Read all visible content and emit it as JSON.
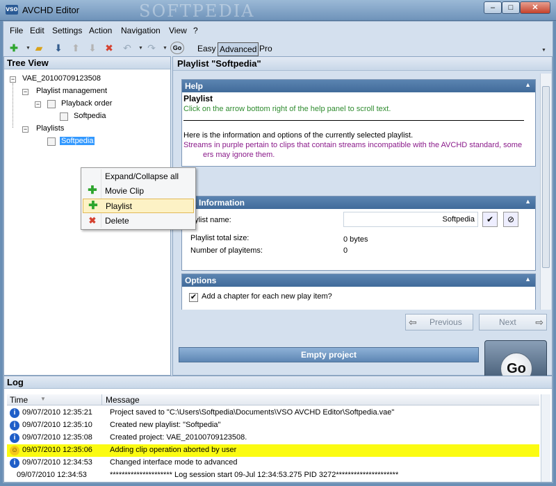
{
  "window": {
    "title": "AVCHD Editor",
    "watermark": "SOFTPEDIA",
    "app_icon_text": "vso"
  },
  "menubar": [
    "File",
    "Edit",
    "Settings",
    "Action",
    "Navigation",
    "View",
    "?"
  ],
  "toolbar": {
    "modes": [
      "Easy",
      "Advanced",
      "Pro"
    ],
    "active_mode": "Advanced",
    "go_label": "Go"
  },
  "tree": {
    "title": "Tree View",
    "root": "VAE_20100709123508",
    "playlist_management": "Playlist management",
    "playback_order": "Playback order",
    "playback_item": "Softpedia",
    "playlists": "Playlists",
    "selected_playlist": "Softpedia"
  },
  "context_menu": {
    "items": [
      "Expand/Collapse all",
      "Movie Clip",
      "Playlist",
      "Delete"
    ],
    "hovered": "Playlist"
  },
  "main": {
    "title": "Playlist \"Softpedia\"",
    "help": {
      "header": "Help",
      "heading": "Playlist",
      "hint": "Click on the arrow bottom right of the help panel to scroll text.",
      "text": "Here is the information and options of the currently selected playlist.",
      "purple_text": "Streams in purple pertain to clips that contain streams incompatible with the AVCHD standard, some",
      "purple_text2": "ers may ignore them."
    },
    "basic_info": {
      "header": "sic Information",
      "name_label": "aylist name:",
      "name_value": "Softpedia",
      "size_label": "Playlist total size:",
      "size_value": "0 bytes",
      "items_label": "Number of playitems:",
      "items_value": "0"
    },
    "options": {
      "header": "Options",
      "chapter_label": "Add a chapter for each new play item?",
      "chapter_checked": true
    },
    "nav": {
      "previous": "Previous",
      "next": "Next"
    },
    "empty_project": "Empty project",
    "go": "Go"
  },
  "log": {
    "title": "Log",
    "columns": [
      "Time",
      "Message"
    ],
    "rows": [
      {
        "icon": "info-icon",
        "time": "09/07/2010 12:35:21",
        "message": "Project saved to \"C:\\Users\\Softpedia\\Documents\\VSO AVCHD Editor\\Softpedia.vae\""
      },
      {
        "icon": "info-icon",
        "time": "09/07/2010 12:35:10",
        "message": "Created new playlist: \"Softpedia\""
      },
      {
        "icon": "info-icon",
        "time": "09/07/2010 12:35:08",
        "message": "Created project: VAE_20100709123508."
      },
      {
        "icon": "warning-smiley-icon",
        "time": "09/07/2010 12:35:06",
        "message": "Adding clip operation aborted by user",
        "highlight": true
      },
      {
        "icon": "info-icon",
        "time": "09/07/2010 12:34:53",
        "message": "Changed interface mode to advanced"
      },
      {
        "icon": "none",
        "time": "09/07/2010 12:34:53",
        "message": "********************* Log session start 09-Jul 12:34:53.275 PID 3272*********************"
      }
    ]
  },
  "colors": {
    "accent": "#5b84b1",
    "help_hint": "#2e8b2e",
    "purple": "#8a1a8a",
    "warning_row": "#fbfb12"
  }
}
